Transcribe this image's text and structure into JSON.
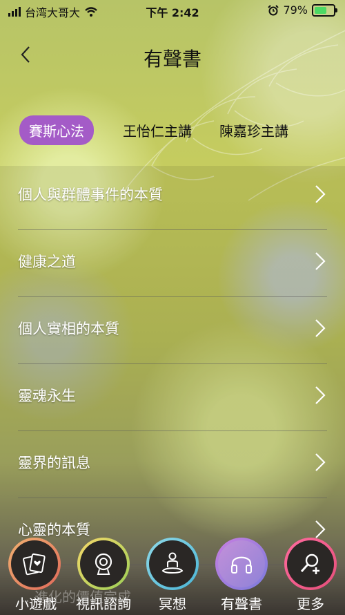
{
  "status_bar": {
    "carrier": "台湾大哥大",
    "time": "下午 2:42",
    "battery": "79%",
    "battery_level": 0.79,
    "icons": [
      "signal-icon",
      "wifi-icon",
      "alarm-icon",
      "battery-icon"
    ]
  },
  "header": {
    "title": "有聲書",
    "back_icon": "chevron-left-icon"
  },
  "tabs": [
    {
      "label": "賽斯心法",
      "active": true
    },
    {
      "label": "王怡仁主講",
      "active": false
    },
    {
      "label": "陳嘉珍主講",
      "active": false
    }
  ],
  "list": {
    "items": [
      {
        "label": "個人與群體事件的本質"
      },
      {
        "label": "健康之道"
      },
      {
        "label": "個人實相的本質"
      },
      {
        "label": "靈魂永生"
      },
      {
        "label": "靈界的訊息"
      },
      {
        "label": "心靈的本質"
      }
    ]
  },
  "ticker": "…進化的價值完成",
  "bottom_nav": {
    "items": [
      {
        "label": "小遊戲",
        "icon": "cards-icon"
      },
      {
        "label": "視訊諮詢",
        "icon": "webcam-icon"
      },
      {
        "label": "冥想",
        "icon": "meditation-icon"
      },
      {
        "label": "有聲書",
        "icon": "headphones-icon",
        "active": true
      },
      {
        "label": "更多",
        "icon": "add-user-icon"
      }
    ]
  },
  "colors": {
    "tab_active_bg": "#a45bc7",
    "accent_purple": "#a45bc7"
  }
}
